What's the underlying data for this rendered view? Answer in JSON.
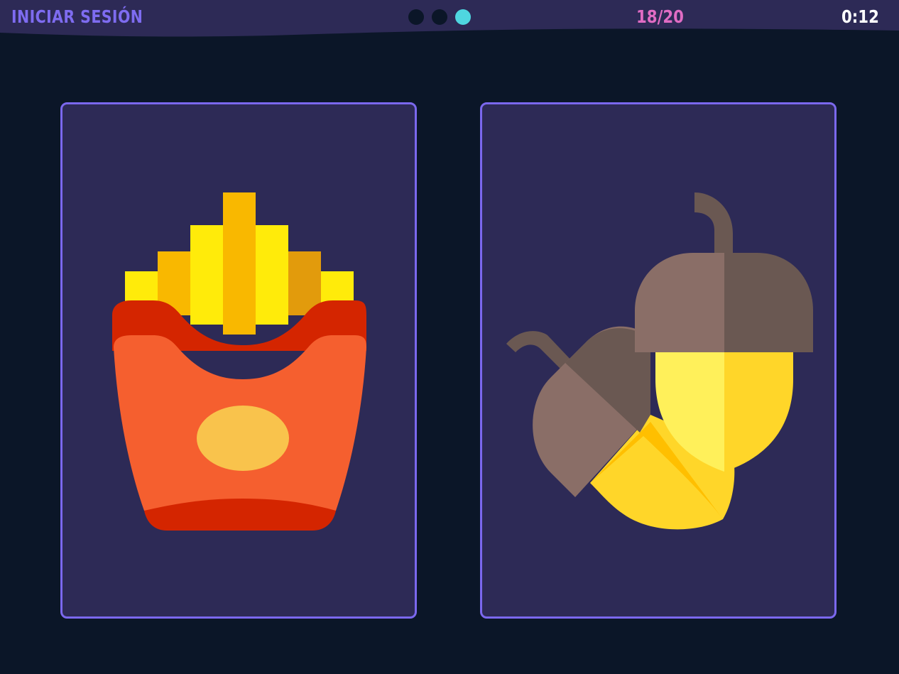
{
  "header": {
    "login_label": "INICIAR SESIÓN",
    "progress_dots": [
      {
        "state": "inactive"
      },
      {
        "state": "inactive"
      },
      {
        "state": "active"
      }
    ],
    "round_counter": "18/20",
    "timer": "0:12"
  },
  "cards": [
    {
      "name": "card-french-fries",
      "icon": "french-fries-icon"
    },
    {
      "name": "card-acorns",
      "icon": "acorns-icon"
    }
  ],
  "colors": {
    "background": "#0b1628",
    "header_bg": "#2d2a56",
    "card_bg": "#2d2a56",
    "card_border": "#7b68ee",
    "login_text": "#7e6cf0",
    "counter_text": "#e06cc4",
    "timer_text": "#ffffff",
    "dot_inactive": "#0b1628",
    "dot_active": "#4fd6e0"
  }
}
